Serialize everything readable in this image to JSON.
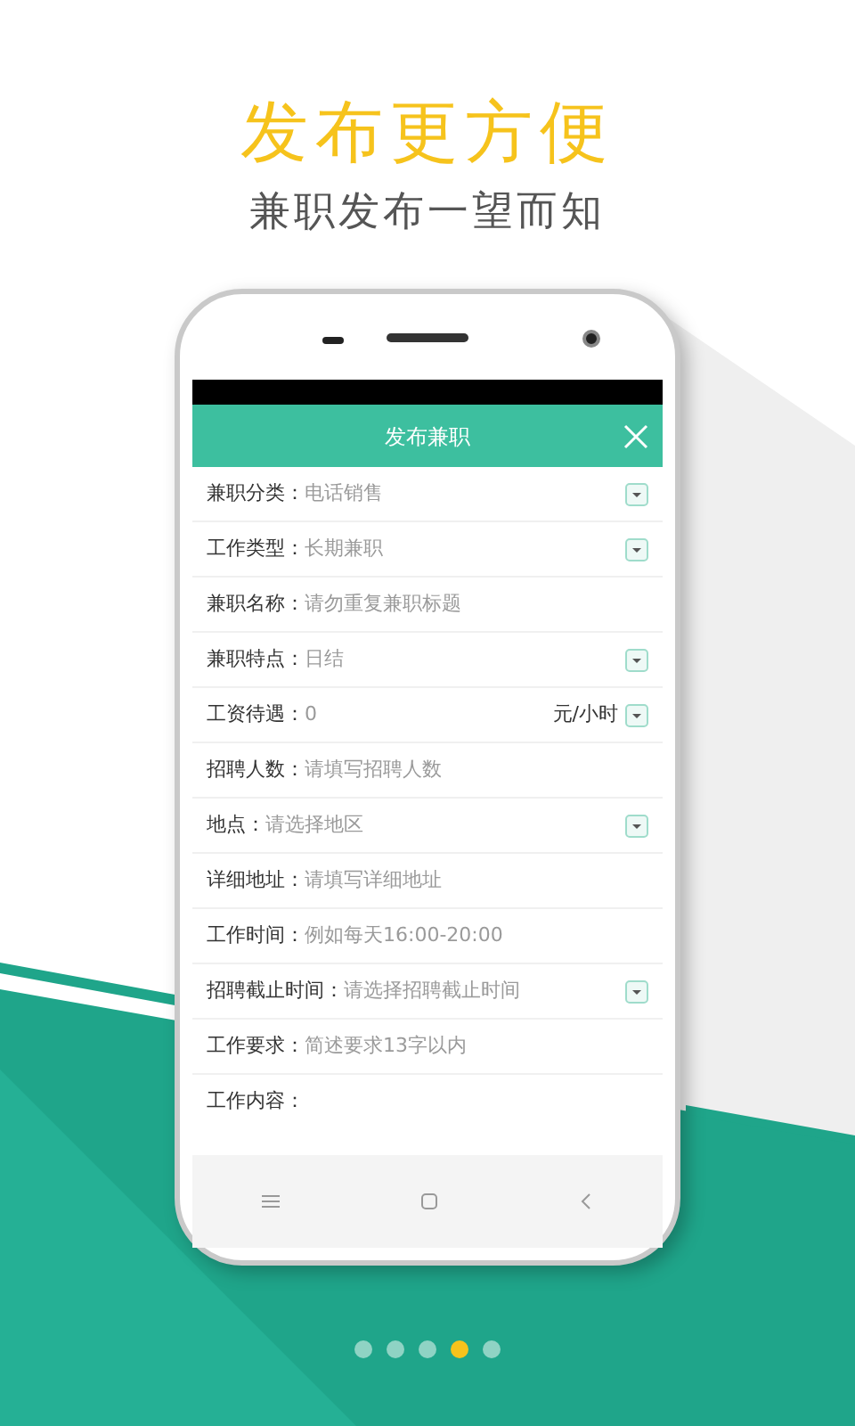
{
  "headline": "发布更方便",
  "subheadline": "兼职发布一望而知",
  "screen": {
    "title": "发布兼职",
    "fields": [
      {
        "label": "兼职分类：",
        "kind": "select",
        "value": "电话销售"
      },
      {
        "label": "工作类型：",
        "kind": "select",
        "value": "长期兼职"
      },
      {
        "label": "兼职名称：",
        "kind": "input",
        "placeholder": "请勿重复兼职标题"
      },
      {
        "label": "兼职特点：",
        "kind": "select",
        "value": "日结"
      },
      {
        "label": "工资待遇：",
        "kind": "unit",
        "value": "0",
        "unit": "元/小时"
      },
      {
        "label": "招聘人数：",
        "kind": "input",
        "placeholder": "请填写招聘人数"
      },
      {
        "label": "地点：",
        "kind": "select",
        "value": "请选择地区"
      },
      {
        "label": "详细地址：",
        "kind": "input",
        "placeholder": "请填写详细地址"
      },
      {
        "label": "工作时间：",
        "kind": "input",
        "placeholder": "例如每天16:00-20:00"
      },
      {
        "label": "招聘截止时间：",
        "kind": "select",
        "value": "请选择招聘截止时间"
      },
      {
        "label": "工作要求：",
        "kind": "input",
        "placeholder": "简述要求13字以内"
      },
      {
        "label": "工作内容：",
        "kind": "textarea"
      }
    ]
  },
  "pager": [
    {
      "selected": false
    },
    {
      "selected": false
    },
    {
      "selected": false
    },
    {
      "selected": true
    },
    {
      "selected": false
    }
  ]
}
